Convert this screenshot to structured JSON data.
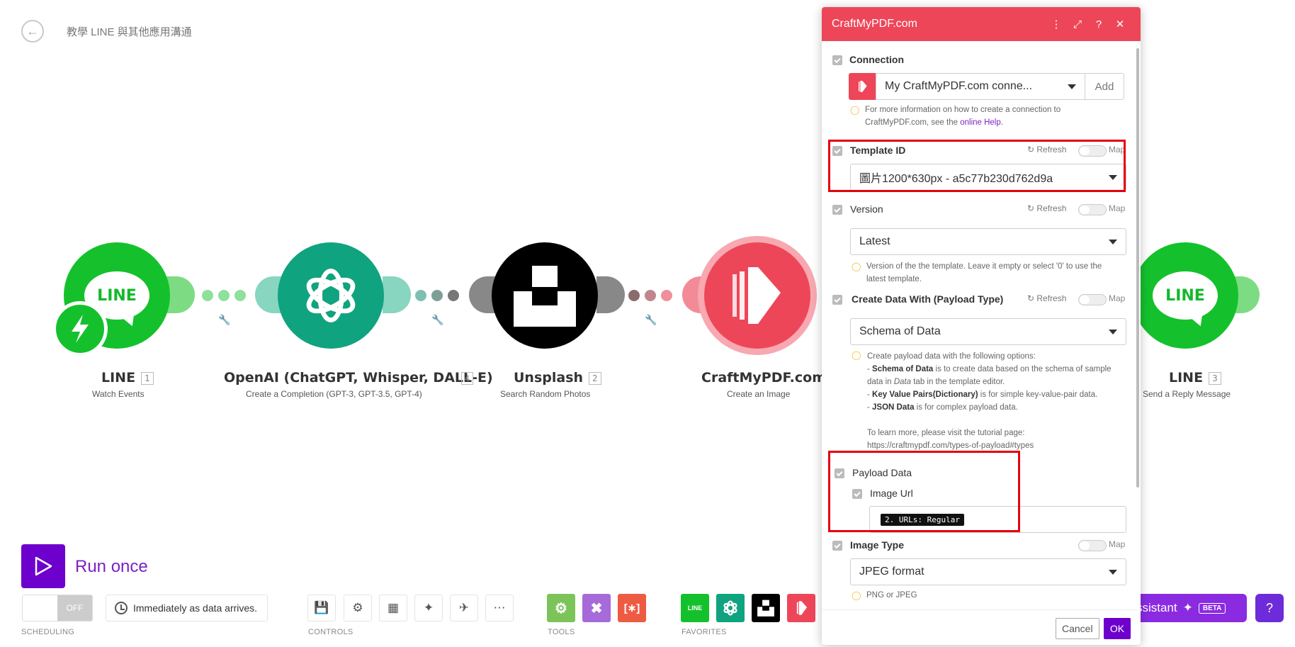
{
  "header": {
    "title": "教學 LINE 與其他應用溝通"
  },
  "modules": [
    {
      "name": "LINE",
      "num": "1",
      "sub": "Watch Events"
    },
    {
      "name": "OpenAI (ChatGPT, Whisper, DALL-E)",
      "num": "4",
      "sub": "Create a Completion (GPT-3, GPT-3.5, GPT-4)"
    },
    {
      "name": "Unsplash",
      "num": "2",
      "sub": "Search Random Photos"
    },
    {
      "name": "CraftMyPDF.com",
      "num": "",
      "sub": "Create an Image"
    },
    {
      "name": "LINE",
      "num": "3",
      "sub": "Send a Reply Message"
    }
  ],
  "line_logo_text": "LINE",
  "toolbar": {
    "run_label": "Run once",
    "toggle_off": "OFF",
    "schedule_text": "Immediately as data arrives.",
    "scheduling_label": "SCHEDULING",
    "controls_label": "CONTROLS",
    "tools_label": "TOOLS",
    "favorites_label": "FAVORITES",
    "assistant_label": "ssistant",
    "beta_label": "BETA"
  },
  "panel": {
    "title": "CraftMyPDF.com",
    "connection": {
      "label": "Connection",
      "value": "My CraftMyPDF.com conne...",
      "add_label": "Add",
      "hint_prefix": "For more information on how to create a connection to CraftMyPDF.com, see the ",
      "hint_link": "online Help",
      "hint_suffix": "."
    },
    "refresh_label": "Refresh",
    "map_label": "Map",
    "template_id": {
      "label": "Template ID",
      "value": "圖片1200*630px - a5c77b230d762d9a"
    },
    "version": {
      "label": "Version",
      "value": "Latest",
      "hint": "Version of the the template. Leave it empty or select '0' to use the latest template."
    },
    "payload_type": {
      "label": "Create Data With (Payload Type)",
      "value": "Schema of Data",
      "hint_intro": "Create payload data with the following options:",
      "opt1_bold": "Schema of Data",
      "opt1_pre": " is to create data based on the schema of sample data in ",
      "opt1_em": "Data",
      "opt1_post": " tab in the template editor.",
      "opt2_bold": "Key Value Pairs(Dictionary)",
      "opt2_post": " is for simple key-value-pair data.",
      "opt3_bold": "JSON Data",
      "opt3_post": " is for complex payload data.",
      "learn": "To learn more, please visit the tutorial page:",
      "url": "https://craftmypdf.com/types-of-payload#types"
    },
    "payload_data": {
      "label": "Payload Data",
      "image_url_label": "Image Url",
      "pill": "2. URLs: Regular"
    },
    "image_type": {
      "label": "Image Type",
      "value": "JPEG format",
      "hint": "PNG or JPEG"
    },
    "cancel_label": "Cancel",
    "ok_label": "OK"
  },
  "colors": {
    "line_green": "#06c755",
    "openai_teal": "#10a37f",
    "craft_red": "#ee4659",
    "accent_purple": "#6d00cc",
    "highlight_red": "#e3000f"
  }
}
